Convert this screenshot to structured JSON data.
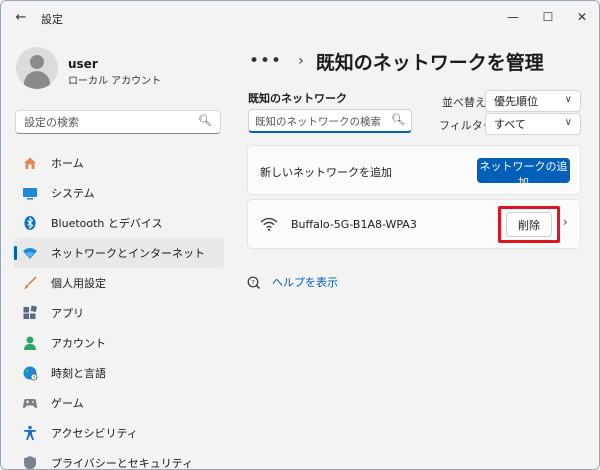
{
  "window": {
    "title": "設定",
    "back_icon": "←",
    "minimize_icon": "—",
    "maximize_icon": "☐",
    "close_icon": "✕"
  },
  "profile": {
    "name": "user",
    "account_type": "ローカル アカウント"
  },
  "sidebar": {
    "search_placeholder": "設定の検索",
    "items": [
      {
        "label": "ホーム",
        "icon": "home-icon",
        "active": false
      },
      {
        "label": "システム",
        "icon": "system-icon",
        "active": false
      },
      {
        "label": "Bluetooth とデバイス",
        "icon": "bluetooth-icon",
        "active": false
      },
      {
        "label": "ネットワークとインターネット",
        "icon": "network-icon",
        "active": true
      },
      {
        "label": "個人用設定",
        "icon": "brush-icon",
        "active": false
      },
      {
        "label": "アプリ",
        "icon": "apps-icon",
        "active": false
      },
      {
        "label": "アカウント",
        "icon": "account-icon",
        "active": false
      },
      {
        "label": "時刻と言語",
        "icon": "globe-icon",
        "active": false
      },
      {
        "label": "ゲーム",
        "icon": "gamepad-icon",
        "active": false
      },
      {
        "label": "アクセシビリティ",
        "icon": "accessibility-icon",
        "active": false
      },
      {
        "label": "プライバシーとセキュリティ",
        "icon": "shield-icon",
        "active": false
      }
    ]
  },
  "main": {
    "breadcrumb_more": "•••",
    "breadcrumb_sep": "›",
    "title": "既知のネットワークを管理",
    "known_networks_label": "既知のネットワーク",
    "network_search_placeholder": "既知のネットワークの検索",
    "sort_label": "並べ替え:",
    "sort_value": "優先順位",
    "filter_label": "フィルター:",
    "filter_value": "すべて",
    "add_network_label": "新しいネットワークを追加",
    "add_network_button": "ネットワークの追加",
    "networks": [
      {
        "ssid": "Buffalo-5G-B1A8-WPA3",
        "delete_label": "削除"
      }
    ],
    "help_link": "ヘルプを表示"
  },
  "colors": {
    "accent": "#005fb8",
    "highlight": "#e0141e"
  }
}
